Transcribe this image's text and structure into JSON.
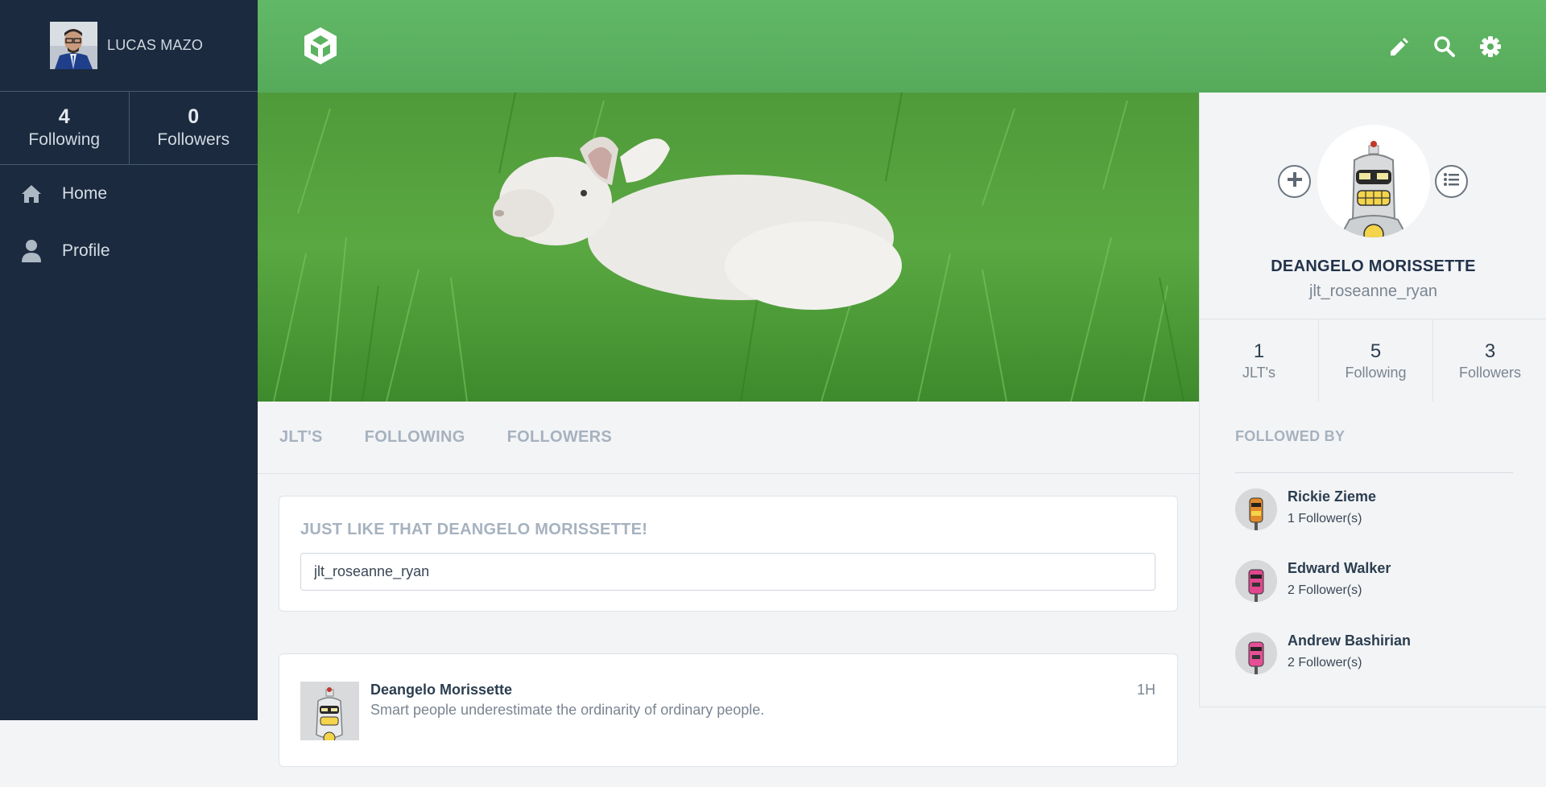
{
  "sidebar": {
    "user_name": "LUCAS MAZO",
    "following_count": "4",
    "following_label": "Following",
    "followers_count": "0",
    "followers_label": "Followers",
    "nav": [
      {
        "label": "Home",
        "icon": "home-icon"
      },
      {
        "label": "Profile",
        "icon": "user-icon"
      }
    ]
  },
  "topbar": {
    "icons": [
      "edit-icon",
      "search-icon",
      "settings-icon"
    ],
    "accent": "#5cb360"
  },
  "profile": {
    "name": "DEANGELO MORISSETTE",
    "handle": "jlt_roseanne_ryan",
    "stats": [
      {
        "num": "1",
        "label": "JLT's"
      },
      {
        "num": "5",
        "label": "Following"
      },
      {
        "num": "3",
        "label": "Followers"
      }
    ]
  },
  "tabs": [
    "JLT'S",
    "FOLLOWING",
    "FOLLOWERS"
  ],
  "composer": {
    "title": "JUST LIKE THAT DEANGELO MORISSETTE!",
    "value": "jlt_roseanne_ryan"
  },
  "post": {
    "author": "Deangelo Morissette",
    "text": "Smart people underestimate the ordinarity of ordinary people.",
    "time": "1H"
  },
  "followed_by": {
    "title": "FOLLOWED BY",
    "items": [
      {
        "name": "Rickie Zieme",
        "count": "1 Follower(s)"
      },
      {
        "name": "Edward Walker",
        "count": "2 Follower(s)"
      },
      {
        "name": "Andrew Bashirian",
        "count": "2 Follower(s)"
      }
    ]
  }
}
